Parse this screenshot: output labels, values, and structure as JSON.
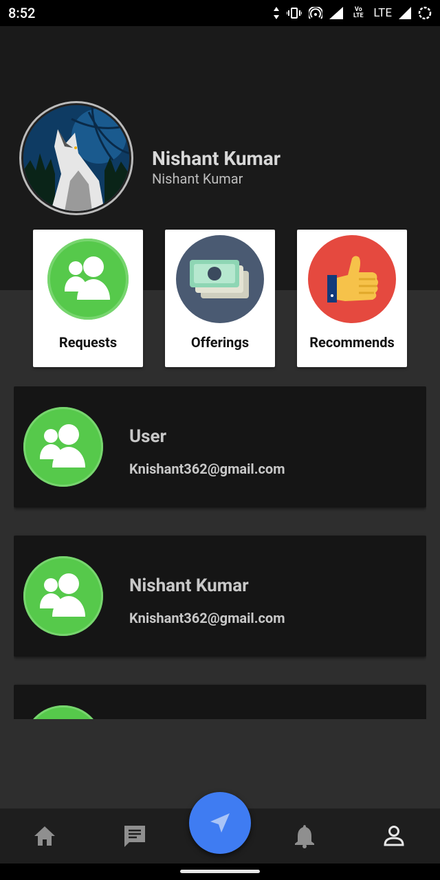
{
  "status_bar": {
    "time": "8:52",
    "network_label": "LTE",
    "volte_label": "Vo LTE"
  },
  "profile": {
    "name": "Nishant Kumar",
    "subtitle": "Nishant Kumar",
    "avatar_icon": "wolf-logo"
  },
  "tiles": [
    {
      "label": "Requests",
      "icon": "users-icon",
      "color": "#56c94b"
    },
    {
      "label": "Offerings",
      "icon": "money-icon",
      "color": "#4a5a72"
    },
    {
      "label": "Recommends",
      "icon": "thumbs-up-icon",
      "color": "#e5493f"
    }
  ],
  "list": [
    {
      "title": "User",
      "email": "Knishant362@gmail.com"
    },
    {
      "title": "Nishant Kumar",
      "email": "Knishant362@gmail.com"
    },
    {
      "title": "",
      "email": ""
    }
  ],
  "bottom_nav": [
    "home-icon",
    "chat-icon",
    "send-icon",
    "bell-icon",
    "person-icon"
  ],
  "colors": {
    "header_bg": "#1a1a1a",
    "body_bg": "#2e2e2e",
    "card_bg": "#151515",
    "fab": "#3f7cf2"
  }
}
